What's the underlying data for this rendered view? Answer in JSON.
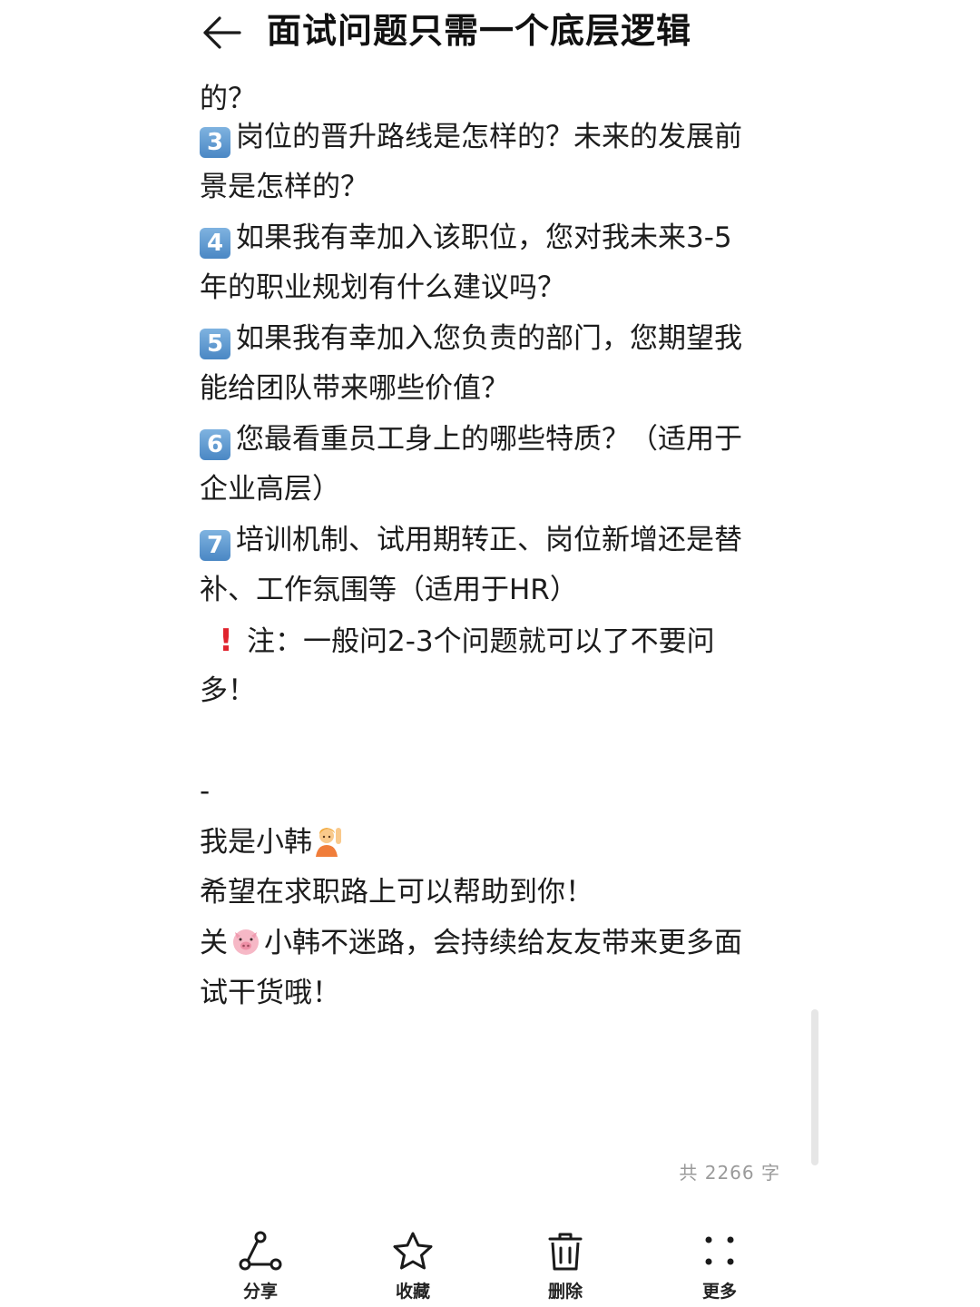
{
  "header": {
    "title": "面试问题只需一个底层逻辑"
  },
  "content": {
    "clipped_top": "的？",
    "items": [
      {
        "badge": "3",
        "line1": "岗位的晋升路线是怎样的？未来的发展前",
        "line2": "景是怎样的？"
      },
      {
        "badge": "4",
        "line1": "如果我有幸加入该职位，您对我未来3-5",
        "line2": "年的职业规划有什么建议吗？"
      },
      {
        "badge": "5",
        "line1": "如果我有幸加入您负责的部门，您期望我",
        "line2": "能给团队带来哪些价值？"
      },
      {
        "badge": "6",
        "line1": "您最看重员工身上的哪些特质？（适用于",
        "line2": "企业高层）"
      },
      {
        "badge": "7",
        "line1": "培训机制、试用期转正、岗位新增还是替",
        "line2": "补、工作氛围等（适用于HR）"
      }
    ],
    "note_icon": "!",
    "note_line1": "注：一般问2-3个问题就可以了不要问",
    "note_line2": "多！",
    "dash": "-",
    "intro": "我是小韩",
    "wish": "希望在求职路上可以帮助到你！",
    "follow_prefix": "关",
    "follow_rest": "小韩不迷路，会持续给友友带来更多面",
    "follow_line2": "试干货哦！"
  },
  "word_count": "共 2266 字",
  "toolbar": {
    "share_label": "分享",
    "favorite_label": "收藏",
    "delete_label": "删除",
    "more_label": "更多"
  },
  "icons": {
    "back": "arrow-left-icon",
    "share": "share-icon",
    "favorite": "star-icon",
    "delete": "trash-icon",
    "more": "dots-grid-icon",
    "note": "exclamation-icon",
    "raise_hand": "person-raising-hand-emoji",
    "pig": "pig-face-emoji"
  },
  "colors": {
    "badge": "#5a95cf",
    "warn": "#e0242e",
    "muted": "#9a9a9a"
  }
}
